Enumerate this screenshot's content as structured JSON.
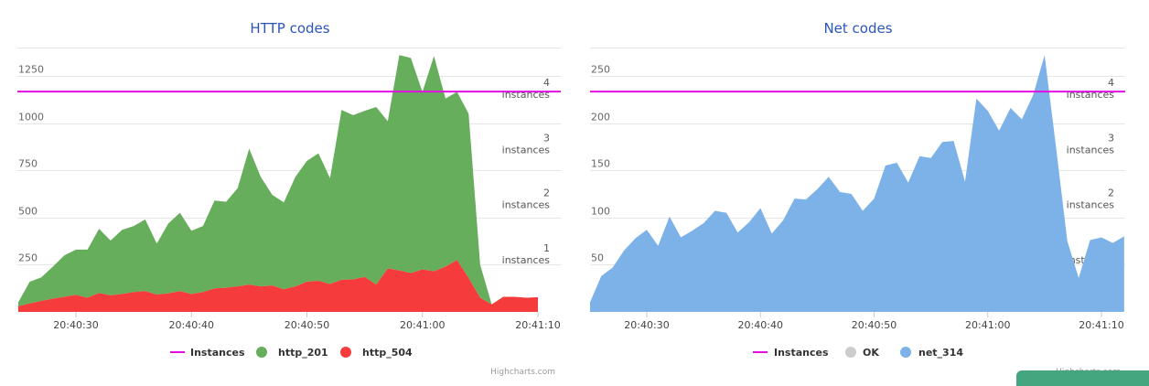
{
  "charts": [
    {
      "id": "http",
      "title": "HTTP codes",
      "credits": "Highcharts.com",
      "legend": [
        {
          "label": "Instances",
          "symbol": "line",
          "color": "#e20fe2",
          "enabled": true
        },
        {
          "label": "http_201",
          "symbol": "circle",
          "color": "#66ae5c",
          "enabled": true
        },
        {
          "label": "http_504",
          "symbol": "circle",
          "color": "#f53b3b",
          "enabled": true
        }
      ]
    },
    {
      "id": "net",
      "title": "Net codes",
      "credits": "Highcharts.com",
      "legend": [
        {
          "label": "Instances",
          "symbol": "line",
          "color": "#e20fe2",
          "enabled": true
        },
        {
          "label": "OK",
          "symbol": "circle",
          "color": "#cccccc",
          "enabled": false
        },
        {
          "label": "net_314",
          "symbol": "circle",
          "color": "#7cb2e8",
          "enabled": true
        }
      ]
    }
  ],
  "chart_data": [
    {
      "type": "area",
      "title": "HTTP codes",
      "stacked": true,
      "x_start": "20:40:25",
      "x_step_seconds": 1,
      "xticks": [
        "20:40:30",
        "20:40:40",
        "20:40:50",
        "20:41:00",
        "20:41:10"
      ],
      "ylim": [
        0,
        1400
      ],
      "yticks": [
        250,
        500,
        750,
        1000,
        1250
      ],
      "grid": true,
      "legend_position": "bottom",
      "right_axis": {
        "ylim": [
          0,
          4.8
        ],
        "ticks": [
          1,
          2,
          3,
          4
        ],
        "tick_suffix": "instances"
      },
      "series": [
        {
          "name": "http_504",
          "color": "#f53b3b",
          "values": [
            30,
            45,
            58,
            70,
            80,
            90,
            75,
            100,
            88,
            95,
            105,
            110,
            92,
            98,
            110,
            95,
            105,
            125,
            128,
            135,
            145,
            135,
            140,
            120,
            135,
            160,
            165,
            148,
            170,
            172,
            185,
            145,
            230,
            220,
            205,
            225,
            215,
            240,
            275,
            180,
            75,
            40,
            80,
            80,
            75,
            78
          ]
        },
        {
          "name": "http_201",
          "color": "#66ae5c",
          "values": [
            20,
            115,
            125,
            170,
            220,
            240,
            255,
            340,
            290,
            340,
            350,
            380,
            270,
            370,
            415,
            335,
            350,
            465,
            455,
            520,
            720,
            580,
            480,
            460,
            580,
            640,
            675,
            560,
            900,
            870,
            880,
            940,
            780,
            1140,
            1140,
            940,
            1140,
            890,
            890,
            870,
            175,
            0,
            0,
            0,
            0,
            0
          ]
        },
        {
          "name": "Instances",
          "color": "#e20fe2",
          "axis": "right",
          "values": [
            4,
            4
          ]
        }
      ]
    },
    {
      "type": "area",
      "title": "Net codes",
      "stacked": true,
      "x_start": "20:40:25",
      "x_step_seconds": 1,
      "xticks": [
        "20:40:30",
        "20:40:40",
        "20:40:50",
        "20:41:00",
        "20:41:10"
      ],
      "ylim": [
        0,
        280
      ],
      "yticks": [
        50,
        100,
        150,
        200,
        250
      ],
      "grid": true,
      "legend_position": "bottom",
      "right_axis": {
        "ylim": [
          0,
          4.8
        ],
        "ticks": [
          1,
          2,
          3,
          4
        ],
        "tick_suffix": "instances"
      },
      "series": [
        {
          "name": "OK",
          "color": "#cccccc",
          "visible": false,
          "values": []
        },
        {
          "name": "net_314",
          "color": "#7cb2e8",
          "values": [
            10,
            38,
            47,
            65,
            78,
            87,
            70,
            101,
            79,
            86,
            94,
            107,
            105,
            84,
            95,
            110,
            83,
            97,
            120,
            119,
            130,
            143,
            127,
            125,
            107,
            120,
            155,
            158,
            137,
            165,
            163,
            180,
            181,
            138,
            226,
            213,
            192,
            216,
            204,
            230,
            272,
            175,
            75,
            36,
            76,
            79,
            73,
            80
          ]
        },
        {
          "name": "Instances",
          "color": "#e20fe2",
          "axis": "right",
          "values": [
            4,
            4
          ]
        }
      ]
    }
  ]
}
